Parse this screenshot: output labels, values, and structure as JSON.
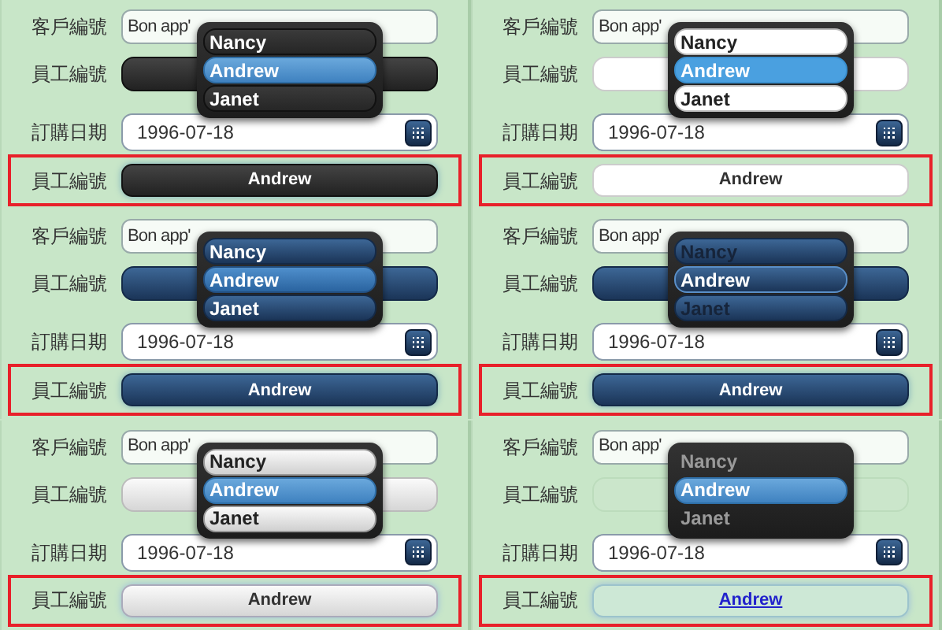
{
  "panels": [
    {
      "kind": "dark",
      "customer": {
        "label": "客戶編號",
        "value": "Bon app'"
      },
      "employee": {
        "label": "員工編號"
      },
      "date": {
        "label": "訂購日期",
        "value": "1996-07-18"
      },
      "highlight": {
        "label": "員工編號",
        "button": "Andrew"
      },
      "popup": [
        {
          "label": "Nancy",
          "selected": false
        },
        {
          "label": "Andrew",
          "selected": true
        },
        {
          "label": "Janet",
          "selected": false
        }
      ]
    },
    {
      "kind": "light",
      "customer": {
        "label": "客戶編號",
        "value": "Bon app'"
      },
      "employee": {
        "label": "員工編號"
      },
      "date": {
        "label": "訂購日期",
        "value": "1996-07-18"
      },
      "highlight": {
        "label": "員工編號",
        "button": "Andrew"
      },
      "popup": [
        {
          "label": "Nancy",
          "selected": false
        },
        {
          "label": "Andrew",
          "selected": true
        },
        {
          "label": "Janet",
          "selected": false
        }
      ]
    },
    {
      "kind": "blue",
      "customer": {
        "label": "客戶編號",
        "value": "Bon app'"
      },
      "employee": {
        "label": "員工編號"
      },
      "date": {
        "label": "訂購日期",
        "value": "1996-07-18"
      },
      "highlight": {
        "label": "員工編號",
        "button": "Andrew"
      },
      "popup": [
        {
          "label": "Nancy",
          "selected": false
        },
        {
          "label": "Andrew",
          "selected": true
        },
        {
          "label": "Janet",
          "selected": false
        }
      ]
    },
    {
      "kind": "navy",
      "customer": {
        "label": "客戶編號",
        "value": "Bon app'"
      },
      "employee": {
        "label": "員工編號"
      },
      "date": {
        "label": "訂購日期",
        "value": "1996-07-18"
      },
      "highlight": {
        "label": "員工編號",
        "button": "Andrew"
      },
      "popup": [
        {
          "label": "Nancy",
          "selected": false
        },
        {
          "label": "Andrew",
          "selected": true
        },
        {
          "label": "Janet",
          "selected": false
        }
      ]
    },
    {
      "kind": "silver",
      "customer": {
        "label": "客戶編號",
        "value": "Bon app'"
      },
      "employee": {
        "label": "員工編號"
      },
      "date": {
        "label": "訂購日期",
        "value": "1996-07-18"
      },
      "highlight": {
        "label": "員工編號",
        "button": "Andrew"
      },
      "popup": [
        {
          "label": "Nancy",
          "selected": false
        },
        {
          "label": "Andrew",
          "selected": true
        },
        {
          "label": "Janet",
          "selected": false
        }
      ]
    },
    {
      "kind": "plain",
      "customer": {
        "label": "客戶編號",
        "value": "Bon app'"
      },
      "employee": {
        "label": "員工編號"
      },
      "date": {
        "label": "訂購日期",
        "value": "1996-07-18"
      },
      "highlight": {
        "label": "員工編號",
        "button": "Andrew"
      },
      "popup": [
        {
          "label": "Nancy",
          "selected": false
        },
        {
          "label": "Andrew",
          "selected": true
        },
        {
          "label": "Janet",
          "selected": false
        }
      ]
    }
  ]
}
